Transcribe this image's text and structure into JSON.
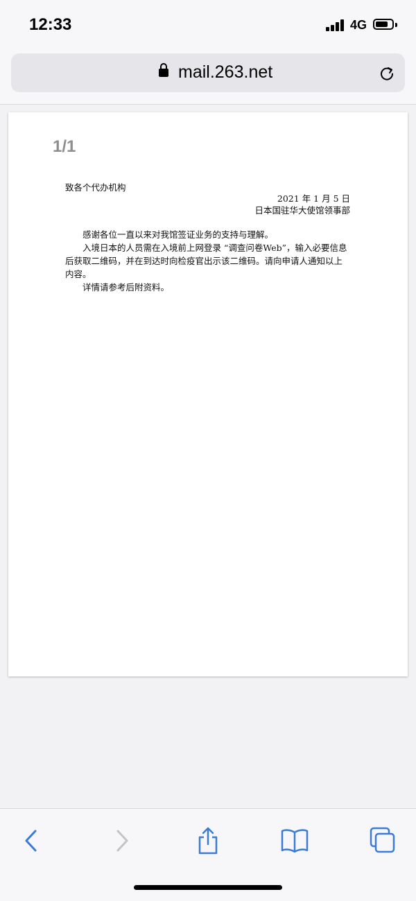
{
  "status_bar": {
    "time": "12:33",
    "network": "4G"
  },
  "address_bar": {
    "url": "mail.263.net",
    "icons": [
      "lock-icon",
      "reload-icon"
    ]
  },
  "document": {
    "page_indicator": "1/1",
    "addressee": "致各个代办机构",
    "date": "2021 年 1 月 5 日",
    "organization": "日本国驻华大使馆领事部",
    "paragraphs": [
      "感谢各位一直以来对我馆签证业务的支持与理解。",
      "入境日本的人员需在入境前上网登录 “调查问卷Web”，输入必要信息后获取二维码，并在到达时向检疫官出示该二维码。请向申请人通知以上内容。",
      "详情请参考后附资料。"
    ]
  },
  "toolbar": {
    "icons": [
      "back-icon",
      "forward-icon",
      "share-icon",
      "bookmarks-icon",
      "tabs-icon"
    ]
  },
  "colors": {
    "accent": "#3a7bd5",
    "disabled": "#c4c4c8",
    "background": "#f2f2f5"
  }
}
